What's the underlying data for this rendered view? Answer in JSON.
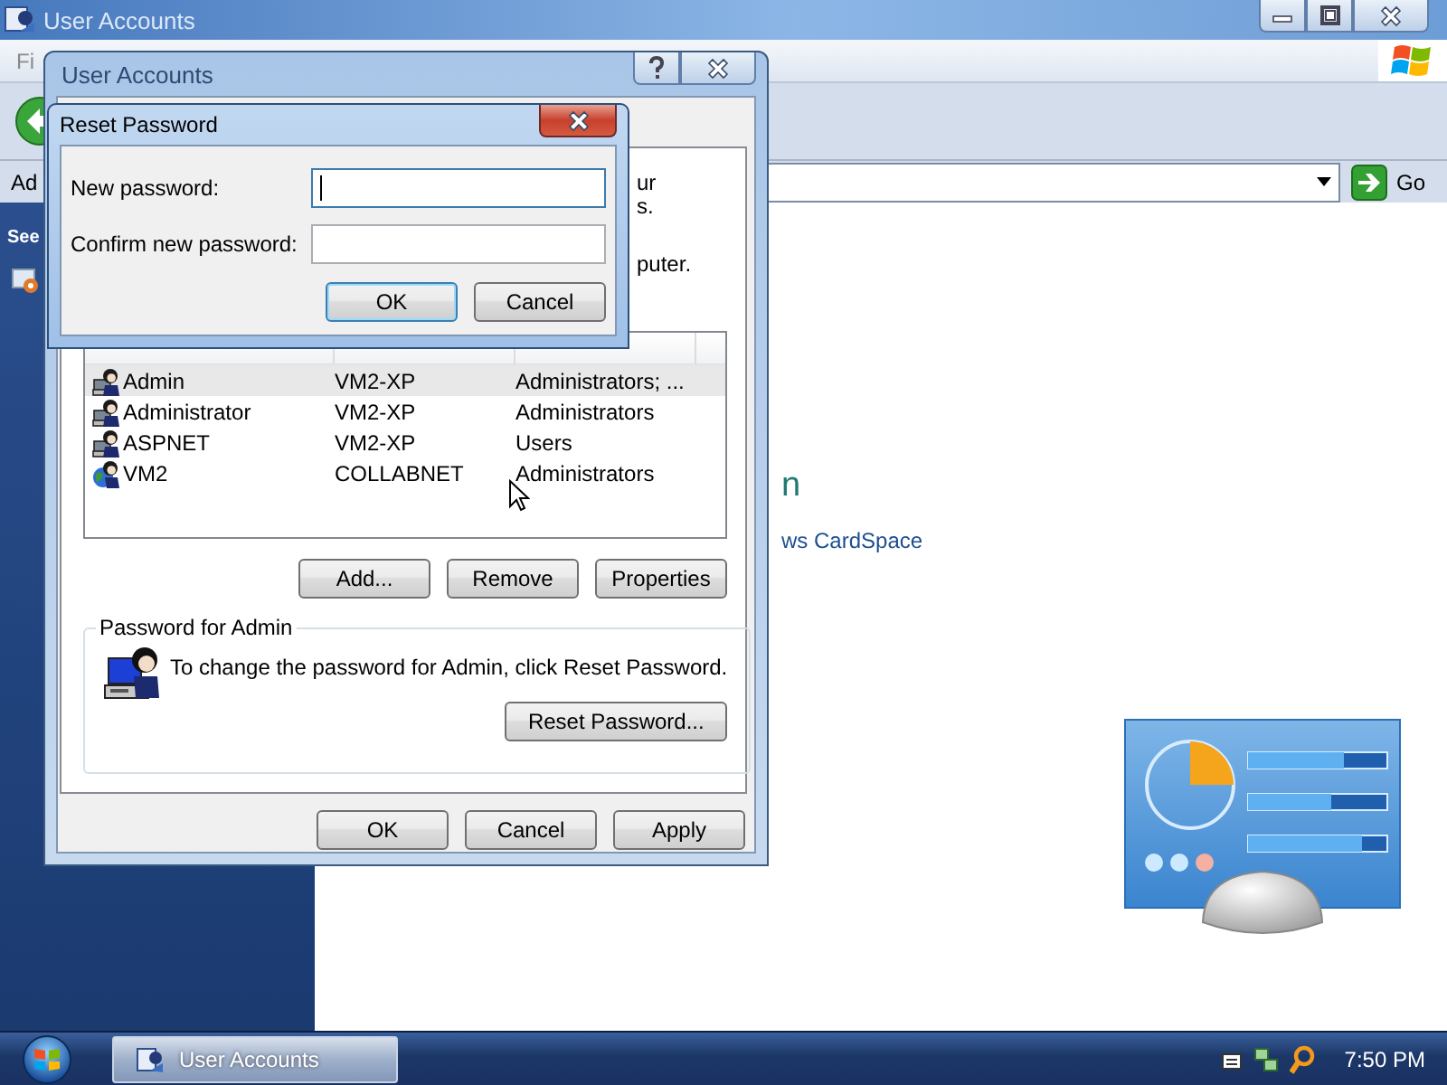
{
  "main_window": {
    "title": "User Accounts",
    "menu": [
      "Fi"
    ],
    "address": {
      "label": "Ad",
      "go": "Go"
    },
    "sidebar": {
      "heading": "See"
    },
    "content": {
      "heading_fragment": "n",
      "link": "ws CardSpace"
    }
  },
  "user_accounts_dialog": {
    "title": "User Accounts",
    "intro_fragments": [
      "ur",
      "s.",
      "puter."
    ],
    "users": [
      {
        "name": "Admin",
        "domain": "VM2-XP",
        "group": "Administrators; ...",
        "kind": "local",
        "selected": true
      },
      {
        "name": "Administrator",
        "domain": "VM2-XP",
        "group": "Administrators",
        "kind": "local",
        "selected": false
      },
      {
        "name": "ASPNET",
        "domain": "VM2-XP",
        "group": "Users",
        "kind": "local",
        "selected": false
      },
      {
        "name": "VM2",
        "domain": "COLLABNET",
        "group": "Administrators",
        "kind": "domain",
        "selected": false
      }
    ],
    "list_buttons": [
      "Add...",
      "Remove",
      "Properties"
    ],
    "password_group": {
      "title": "Password for Admin",
      "text": "To change the password for Admin, click Reset Password.",
      "button": "Reset Password..."
    },
    "buttons": [
      "OK",
      "Cancel",
      "Apply"
    ]
  },
  "reset_password_dialog": {
    "title": "Reset Password",
    "fields": [
      {
        "label": "New password:",
        "focused": true
      },
      {
        "label": "Confirm new password:",
        "focused": false
      }
    ],
    "buttons": [
      {
        "label": "OK",
        "default": true
      },
      {
        "label": "Cancel",
        "default": false
      }
    ]
  },
  "taskbar": {
    "tasks": [
      {
        "label": "User Accounts",
        "selected": true
      }
    ],
    "clock": "7:50 PM"
  }
}
